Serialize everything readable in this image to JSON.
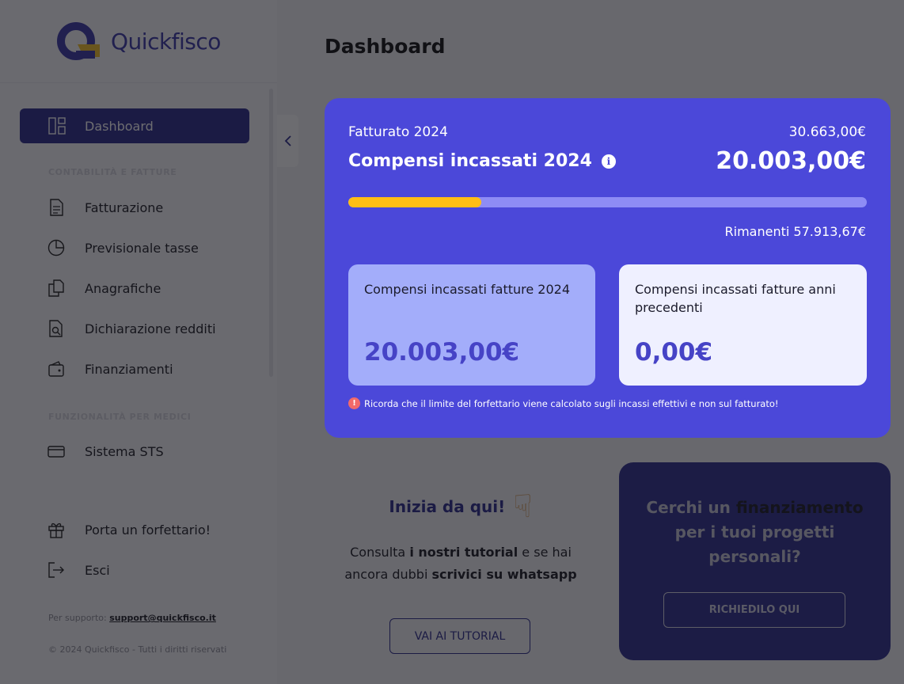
{
  "brand": {
    "name": "Quickfisco"
  },
  "page": {
    "title": "Dashboard"
  },
  "sidebar": {
    "items": [
      {
        "label": "Dashboard",
        "icon": "dashboard-icon"
      },
      {
        "label": "Fatturazione",
        "icon": "invoice-icon"
      },
      {
        "label": "Previsionale tasse",
        "icon": "pie-chart-icon"
      },
      {
        "label": "Anagrafiche",
        "icon": "documents-icon"
      },
      {
        "label": "Dichiarazione redditi",
        "icon": "tax-return-icon"
      },
      {
        "label": "Finanziamenti",
        "icon": "wallet-icon"
      },
      {
        "label": "Sistema STS",
        "icon": "card-icon"
      },
      {
        "label": "Porta un forfettario!",
        "icon": "gift-icon"
      },
      {
        "label": "Esci",
        "icon": "logout-icon"
      }
    ],
    "sections": [
      "CONTABILITÀ E FATTURE",
      "FUNZIONALITÀ PER MEDICI"
    ],
    "support_prefix": "Per supporto:",
    "support_email": "support@quickfisco.it",
    "copyright": "© 2024 Quickfisco - Tutti i diritti riservati"
  },
  "revenue": {
    "fatturato_label": "Fatturato 2024",
    "fatturato_value": "30.663,00€",
    "compensi_label": "Compensi incassati 2024",
    "compensi_value": "20.003,00€",
    "progress_fraction": 0.257,
    "rimanenti": "Rimanenti 57.913,67€",
    "card_current_title": "Compensi incassati fatture 2024",
    "card_current_value": "20.003,00€",
    "card_previous_title": "Compensi incassati fatture anni precedenti",
    "card_previous_value": "0,00€",
    "warning": "Ricorda che il limite del forfettario viene calcolato sugli incassi effettivi e non sul fatturato!"
  },
  "tutorial": {
    "title": "Inizia da qui!",
    "text_1": "Consulta",
    "text_bold_1": "i nostri tutorial",
    "text_2": "e se hai ancora dubbi",
    "text_bold_2": "scrivici su whatsapp",
    "button": "VAI AI TUTORIAL"
  },
  "funding": {
    "text_1": "Cerchi un",
    "highlight": "finanziamento",
    "text_2": "per i tuoi progetti personali?",
    "button": "RICHIEDILO QUI"
  },
  "colors": {
    "primary": "#2c2a8c",
    "card": "#4b48d9",
    "accent": "#ffbe15",
    "warning": "#f26a6a"
  }
}
